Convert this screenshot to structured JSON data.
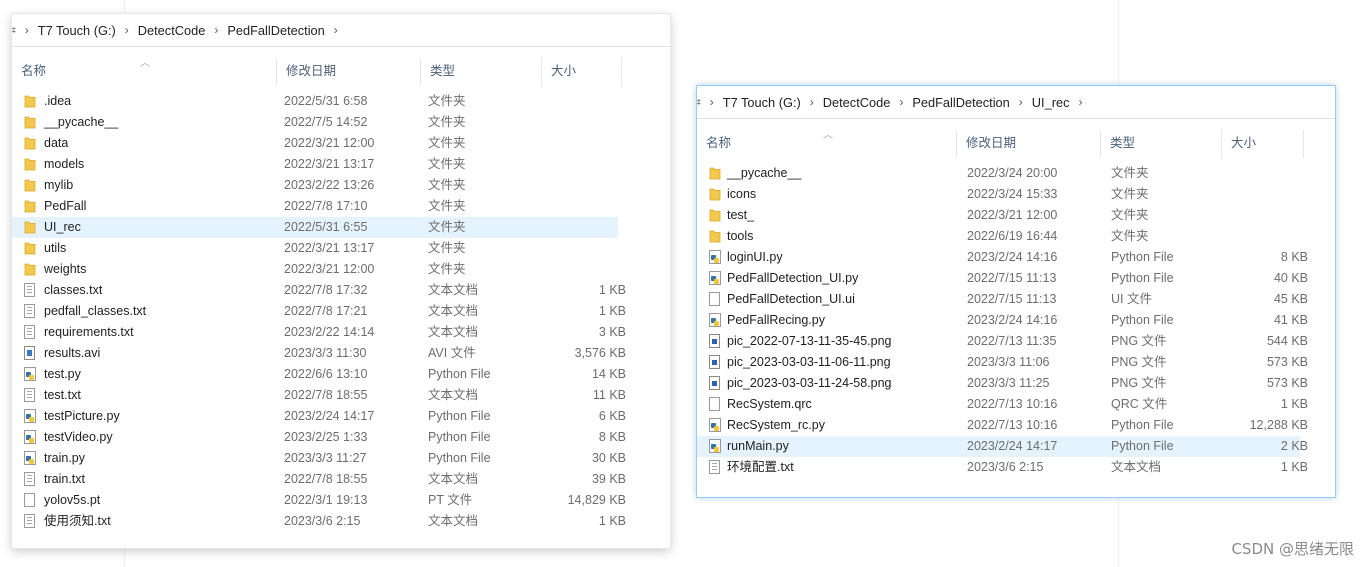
{
  "left_window": {
    "breadcrumb": [
      "T7 Touch (G:)",
      "DetectCode",
      "PedFallDetection"
    ],
    "columns": {
      "name": "名称",
      "date": "修改日期",
      "type": "类型",
      "size": "大小"
    },
    "files": [
      {
        "name": ".idea",
        "date": "2022/5/31 6:58",
        "type": "文件夹",
        "size": "",
        "icon": "folder-icon"
      },
      {
        "name": "__pycache__",
        "date": "2022/7/5 14:52",
        "type": "文件夹",
        "size": "",
        "icon": "folder-icon"
      },
      {
        "name": "data",
        "date": "2022/3/21 12:00",
        "type": "文件夹",
        "size": "",
        "icon": "folder-icon"
      },
      {
        "name": "models",
        "date": "2022/3/21 13:17",
        "type": "文件夹",
        "size": "",
        "icon": "folder-icon"
      },
      {
        "name": "mylib",
        "date": "2023/2/22 13:26",
        "type": "文件夹",
        "size": "",
        "icon": "folder-icon"
      },
      {
        "name": "PedFall",
        "date": "2022/7/8 17:10",
        "type": "文件夹",
        "size": "",
        "icon": "folder-icon"
      },
      {
        "name": "UI_rec",
        "date": "2022/5/31 6:55",
        "type": "文件夹",
        "size": "",
        "icon": "folder-icon",
        "selected": true
      },
      {
        "name": "utils",
        "date": "2022/3/21 13:17",
        "type": "文件夹",
        "size": "",
        "icon": "folder-icon"
      },
      {
        "name": "weights",
        "date": "2022/3/21 12:00",
        "type": "文件夹",
        "size": "",
        "icon": "folder-icon"
      },
      {
        "name": "classes.txt",
        "date": "2022/7/8 17:32",
        "type": "文本文档",
        "size": "1 KB",
        "icon": "text-file-icon"
      },
      {
        "name": "pedfall_classes.txt",
        "date": "2022/7/8 17:21",
        "type": "文本文档",
        "size": "1 KB",
        "icon": "text-file-icon"
      },
      {
        "name": "requirements.txt",
        "date": "2023/2/22 14:14",
        "type": "文本文档",
        "size": "3 KB",
        "icon": "text-file-icon"
      },
      {
        "name": "results.avi",
        "date": "2023/3/3 11:30",
        "type": "AVI 文件",
        "size": "3,576 KB",
        "icon": "video-file-icon"
      },
      {
        "name": "test.py",
        "date": "2022/6/6 13:10",
        "type": "Python File",
        "size": "14 KB",
        "icon": "python-file-icon"
      },
      {
        "name": "test.txt",
        "date": "2022/7/8 18:55",
        "type": "文本文档",
        "size": "11 KB",
        "icon": "text-file-icon"
      },
      {
        "name": "testPicture.py",
        "date": "2023/2/24 14:17",
        "type": "Python File",
        "size": "6 KB",
        "icon": "python-file-icon"
      },
      {
        "name": "testVideo.py",
        "date": "2023/2/25 1:33",
        "type": "Python File",
        "size": "8 KB",
        "icon": "python-file-icon"
      },
      {
        "name": "train.py",
        "date": "2023/3/3 11:27",
        "type": "Python File",
        "size": "30 KB",
        "icon": "python-file-icon"
      },
      {
        "name": "train.txt",
        "date": "2022/7/8 18:55",
        "type": "文本文档",
        "size": "39 KB",
        "icon": "text-file-icon"
      },
      {
        "name": "yolov5s.pt",
        "date": "2022/3/1 19:13",
        "type": "PT 文件",
        "size": "14,829 KB",
        "icon": "file-icon"
      },
      {
        "name": "使用须知.txt",
        "date": "2023/3/6 2:15",
        "type": "文本文档",
        "size": "1 KB",
        "icon": "text-file-icon"
      }
    ]
  },
  "right_window": {
    "breadcrumb": [
      "T7 Touch (G:)",
      "DetectCode",
      "PedFallDetection",
      "UI_rec"
    ],
    "columns": {
      "name": "名称",
      "date": "修改日期",
      "type": "类型",
      "size": "大小"
    },
    "files": [
      {
        "name": "__pycache__",
        "date": "2022/3/24 20:00",
        "type": "文件夹",
        "size": "",
        "icon": "folder-icon"
      },
      {
        "name": "icons",
        "date": "2022/3/24 15:33",
        "type": "文件夹",
        "size": "",
        "icon": "folder-icon"
      },
      {
        "name": "test_",
        "date": "2022/3/21 12:00",
        "type": "文件夹",
        "size": "",
        "icon": "folder-icon"
      },
      {
        "name": "tools",
        "date": "2022/6/19 16:44",
        "type": "文件夹",
        "size": "",
        "icon": "folder-icon"
      },
      {
        "name": "loginUI.py",
        "date": "2023/2/24 14:16",
        "type": "Python File",
        "size": "8 KB",
        "icon": "python-file-icon"
      },
      {
        "name": "PedFallDetection_UI.py",
        "date": "2022/7/15 11:13",
        "type": "Python File",
        "size": "40 KB",
        "icon": "python-file-icon"
      },
      {
        "name": "PedFallDetection_UI.ui",
        "date": "2022/7/15 11:13",
        "type": "UI 文件",
        "size": "45 KB",
        "icon": "file-icon"
      },
      {
        "name": "PedFallRecing.py",
        "date": "2023/2/24 14:16",
        "type": "Python File",
        "size": "41 KB",
        "icon": "python-file-icon"
      },
      {
        "name": "pic_2022-07-13-11-35-45.png",
        "date": "2022/7/13 11:35",
        "type": "PNG 文件",
        "size": "544 KB",
        "icon": "image-file-icon"
      },
      {
        "name": "pic_2023-03-03-11-06-11.png",
        "date": "2023/3/3 11:06",
        "type": "PNG 文件",
        "size": "573 KB",
        "icon": "image-file-icon"
      },
      {
        "name": "pic_2023-03-03-11-24-58.png",
        "date": "2023/3/3 11:25",
        "type": "PNG 文件",
        "size": "573 KB",
        "icon": "image-file-icon"
      },
      {
        "name": "RecSystem.qrc",
        "date": "2022/7/13 10:16",
        "type": "QRC 文件",
        "size": "1 KB",
        "icon": "file-icon"
      },
      {
        "name": "RecSystem_rc.py",
        "date": "2022/7/13 10:16",
        "type": "Python File",
        "size": "12,288 KB",
        "icon": "python-file-icon"
      },
      {
        "name": "runMain.py",
        "date": "2023/2/24 14:17",
        "type": "Python File",
        "size": "2 KB",
        "icon": "python-file-icon",
        "selected": true
      },
      {
        "name": "环境配置.txt",
        "date": "2023/3/6 2:15",
        "type": "文本文档",
        "size": "1 KB",
        "icon": "text-file-icon"
      }
    ]
  },
  "watermark": "CSDN @思绪无限",
  "colors": {
    "folder": "#f2c94c",
    "selection": "#e5f3ff",
    "header_text": "#4c607a",
    "focus_border": "#9ccbf2"
  }
}
